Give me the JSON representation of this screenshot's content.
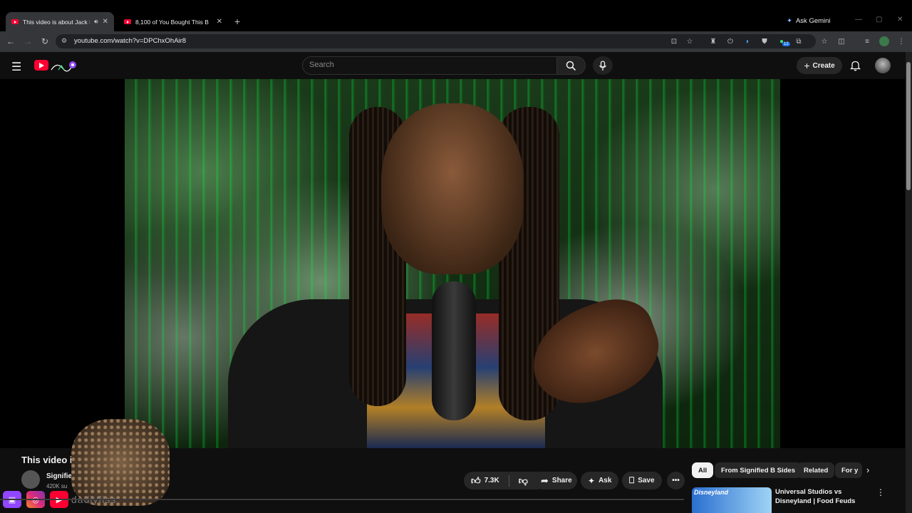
{
  "browser": {
    "tabs": [
      {
        "title": "This video is about Jack Ha",
        "active": true
      },
      {
        "title": "8,100 of You Bought This B",
        "active": false
      }
    ],
    "new_tab_symbol": "+",
    "url": "youtube.com/watch?v=DPChxOhAir8",
    "ask_gemini_label": "Ask Gemini",
    "extension_badge": "12"
  },
  "youtube": {
    "search_placeholder": "Search",
    "create_label": "Create"
  },
  "video": {
    "title": "This video i",
    "channel_name": "Signifie",
    "subscribers": "420K su",
    "overlay_text": "dadlyfiss",
    "likes": "7.3K",
    "share_label": "Share",
    "ask_label": "Ask",
    "save_label": "Save"
  },
  "chips": [
    "All",
    "From Signified B Sides",
    "Related",
    "For y"
  ],
  "recommendation": {
    "thumb_text": "Disneyland",
    "title": "Universal Studios vs Disneyland | Food Feuds"
  },
  "colors": {
    "youtube_red": "#ff0033",
    "twitch_purple": "#9146ff",
    "instagram_pink": "#e1306c"
  }
}
